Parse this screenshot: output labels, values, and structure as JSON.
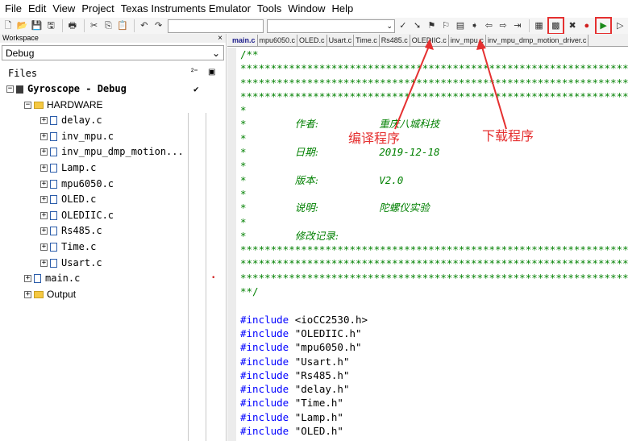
{
  "menu": [
    "File",
    "Edit",
    "View",
    "Project",
    "Texas Instruments Emulator",
    "Tools",
    "Window",
    "Help"
  ],
  "workspace": {
    "title": "Workspace",
    "close": "×",
    "config": "Debug",
    "files_label": "Files",
    "files_icon1": "²⁼",
    "files_icon2": "▣",
    "project": "Gyroscope - Debug",
    "project_check": "✔",
    "hardware_folder": "HARDWARE",
    "hardware_files": [
      "delay.c",
      "inv_mpu.c",
      "inv_mpu_dmp_motion...",
      "Lamp.c",
      "mpu6050.c",
      "OLED.c",
      "OLEDIIC.c",
      "Rs485.c",
      "Time.c",
      "Usart.c"
    ],
    "main_file": "main.c",
    "output_folder": "Output"
  },
  "tabs": [
    "main.c",
    "mpu6050.c",
    "OLED.c",
    "Usart.c",
    "Time.c",
    "Rs485.c",
    "OLEDIIC.c",
    "inv_mpu.c",
    "inv_mpu_dmp_motion_driver.c"
  ],
  "code": {
    "open": "/**",
    "stars": "*******************************************************************",
    "star": "*",
    "author_label": "作者:",
    "author_value": "重庆八城科技",
    "date_label": "日期:",
    "date_value": "2019-12-18",
    "version_label": "版本:",
    "version_value": "V2.0",
    "desc_label": "说明:",
    "desc_value": "陀螺仪实验",
    "log_label": "修改记录:",
    "close": "**/",
    "includes": [
      {
        "kw": "#include",
        "file": "<ioCC2530.h>"
      },
      {
        "kw": "#include",
        "file": "\"OLEDIIC.h\""
      },
      {
        "kw": "#include",
        "file": "\"mpu6050.h\""
      },
      {
        "kw": "#include",
        "file": "\"Usart.h\""
      },
      {
        "kw": "#include",
        "file": "\"Rs485.h\""
      },
      {
        "kw": "#include",
        "file": "\"delay.h\""
      },
      {
        "kw": "#include",
        "file": "\"Time.h\""
      },
      {
        "kw": "#include",
        "file": "\"Lamp.h\""
      },
      {
        "kw": "#include",
        "file": "\"OLED.h\""
      }
    ]
  },
  "annotations": {
    "compile": "编译程序",
    "download": "下载程序"
  },
  "colors": {
    "annotation": "#e53030",
    "comment": "#008000",
    "keyword": "#0000ff"
  }
}
